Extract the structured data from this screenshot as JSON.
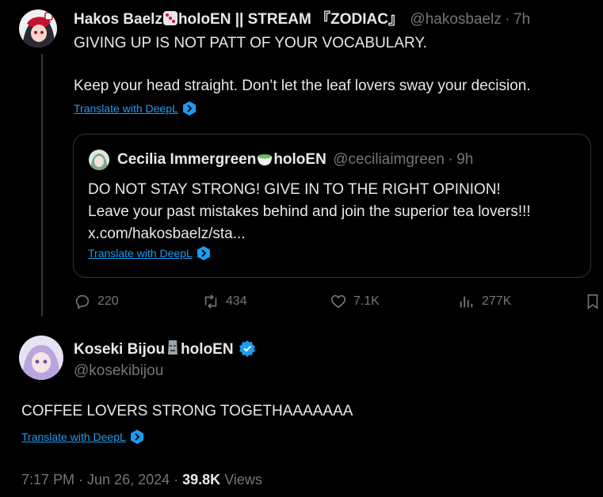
{
  "tweet": {
    "author_name": "Hakos Baelz",
    "author_name_suffix": "holoEN || STREAM 『ZODIAC』",
    "author_handle": "@hakosbaelz",
    "separator": "·",
    "time": "7h",
    "line1": "GIVING UP IS NOT PATT OF YOUR VOCABULARY.",
    "line2": "Keep your head straight. Don’t let the leaf lovers sway your decision.",
    "translate_label": "Translate with DeepL"
  },
  "quote": {
    "author_name": "Cecilia Immergreen",
    "author_name_suffix": "holoEN",
    "author_handle": "@ceciliaimgreen",
    "separator": "·",
    "time": "9h",
    "line1": "DO NOT STAY STRONG! GIVE IN TO THE RIGHT OPINION!",
    "line2": "Leave your past mistakes behind and join the superior tea lovers!!!",
    "line3": "x.com/hakosbaelz/sta...",
    "translate_label": "Translate with DeepL"
  },
  "actions": {
    "replies": "220",
    "reposts": "434",
    "likes": "7.1K",
    "views": "277K"
  },
  "reply": {
    "author_name": "Koseki Bijou",
    "author_name_suffix": "holoEN",
    "author_handle": "@kosekibijou",
    "text": "COFFEE LOVERS STRONG TOGETHAAAAAAA",
    "translate_label": "Translate with DeepL",
    "timestamp": "7:17 PM · Jun 26, 2024 ·",
    "views_count": "39.8K",
    "views_label": "Views"
  },
  "colors": {
    "background": "#000000",
    "text": "#e7e9ea",
    "muted": "#71767b",
    "link": "#1d9bf0",
    "border": "#2f3336",
    "verified": "#1d9bf0"
  },
  "icons": [
    "dice-emoji-icon",
    "tea-emoji-icon",
    "moai-emoji-icon",
    "verified-badge-icon",
    "deepl-icon",
    "reply-icon",
    "repost-icon",
    "like-icon",
    "views-icon",
    "bookmark-icon"
  ]
}
